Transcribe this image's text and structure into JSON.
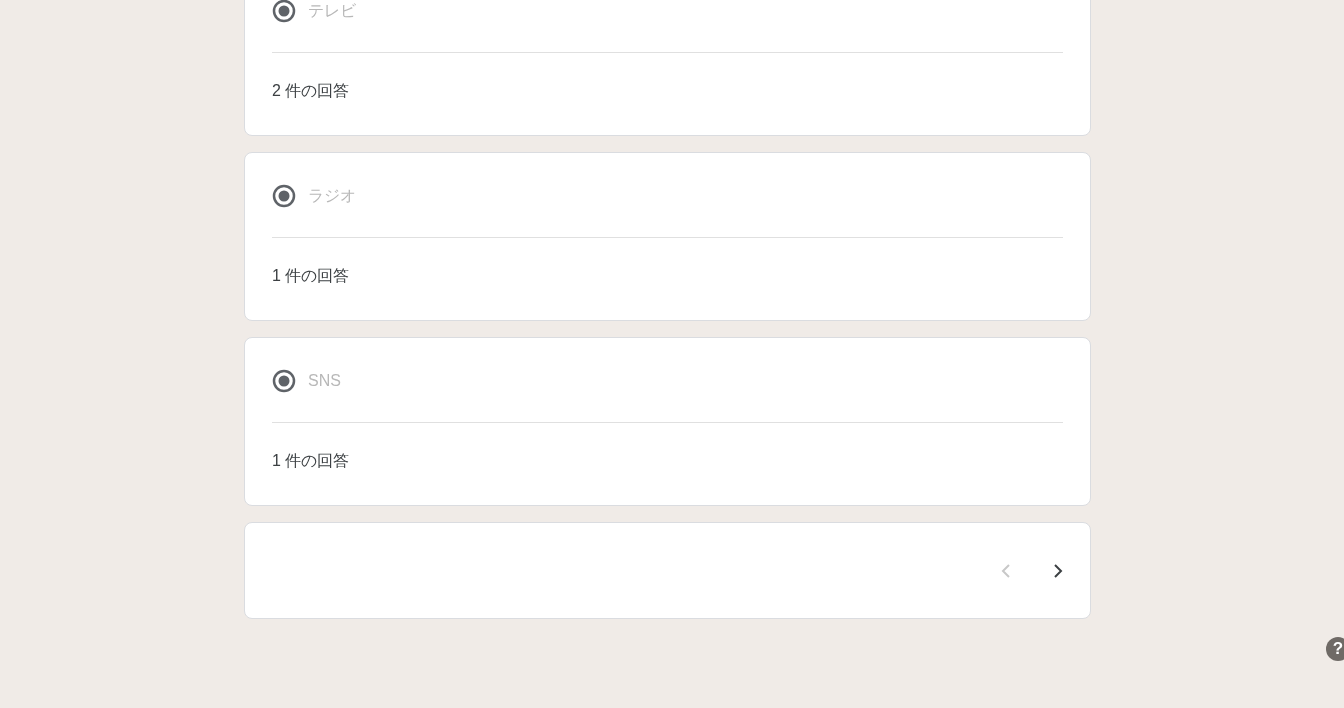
{
  "responses": [
    {
      "option": "テレビ",
      "selected": true,
      "count": "2 件の回答"
    },
    {
      "option": "ラジオ",
      "selected": true,
      "count": "1 件の回答"
    },
    {
      "option": "SNS",
      "selected": true,
      "count": "1 件の回答"
    }
  ],
  "navigation": {
    "previous_disabled": true,
    "next_disabled": false
  },
  "help_button": {
    "label": "?"
  }
}
